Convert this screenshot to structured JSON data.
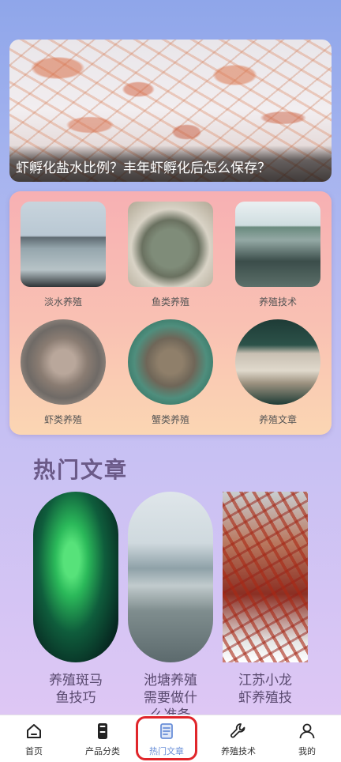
{
  "banner": {
    "caption": "虾孵化盐水比例？丰年虾孵化后怎么保存？"
  },
  "categories": [
    {
      "label": "淡水养殖",
      "icon": "freshwater-thumbnail"
    },
    {
      "label": "鱼类养殖",
      "icon": "fish-thumbnail"
    },
    {
      "label": "养殖技术",
      "icon": "aquaculture-tech-thumbnail"
    },
    {
      "label": "虾类养殖",
      "icon": "shrimp-thumbnail"
    },
    {
      "label": "蟹类养殖",
      "icon": "crab-thumbnail"
    },
    {
      "label": "养殖文章",
      "icon": "article-thumbnail"
    }
  ],
  "hot": {
    "title": "热门文章",
    "articles": [
      {
        "caption": "养殖斑马鱼技巧"
      },
      {
        "caption": "池塘养殖需要做什么准备"
      },
      {
        "caption": "江苏小龙虾养殖技"
      }
    ]
  },
  "tabbar": {
    "items": [
      {
        "label": "首页",
        "icon": "home-icon"
      },
      {
        "label": "产品分类",
        "icon": "phone-icon"
      },
      {
        "label": "热门文章",
        "icon": "article-icon"
      },
      {
        "label": "养殖技术",
        "icon": "wrench-icon"
      },
      {
        "label": "我的",
        "icon": "user-icon"
      }
    ],
    "active_index": 2
  },
  "colors": {
    "active_tab": "#6a8fd8",
    "highlight": "#e0262b",
    "hot_title": "#6b5a88"
  }
}
